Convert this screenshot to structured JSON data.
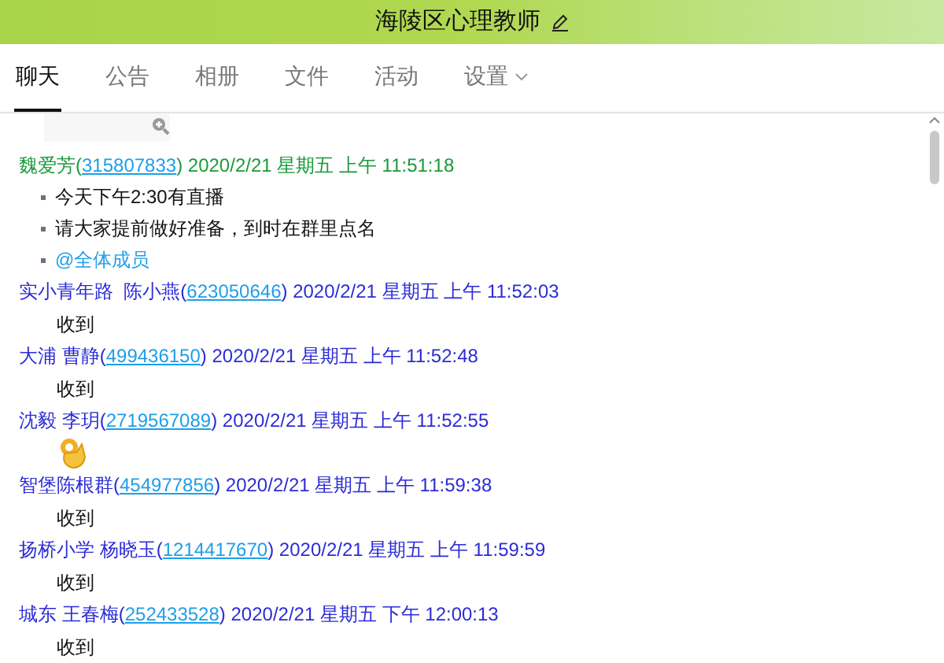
{
  "window": {
    "title": "海陵区心理教师"
  },
  "tabs": [
    {
      "label": "聊天",
      "selected": true
    },
    {
      "label": "公告",
      "selected": false
    },
    {
      "label": "相册",
      "selected": false
    },
    {
      "label": "文件",
      "selected": false
    },
    {
      "label": "活动",
      "selected": false
    },
    {
      "label": "设置",
      "selected": false,
      "dropdown": true
    }
  ],
  "messages": [
    {
      "name": "魏爱芳(",
      "qq": "315807833",
      "time": ") 2020/2/21 星期五 上午 11:51:18",
      "color": "#1a9a3a",
      "lines": [
        {
          "kind": "bullet",
          "text": "今天下午2:30有直播"
        },
        {
          "kind": "bullet",
          "text": "请大家提前做好准备，到时在群里点名"
        },
        {
          "kind": "mention",
          "text": "@全体成员"
        }
      ]
    },
    {
      "name": "实小青年路  陈小燕(",
      "qq": "623050646",
      "time": ") 2020/2/21 星期五 上午 11:52:03",
      "color": "#2b2bd6",
      "lines": [
        {
          "kind": "text",
          "text": "收到"
        }
      ]
    },
    {
      "name": "大浦 曹静(",
      "qq": "499436150",
      "time": ") 2020/2/21 星期五 上午 11:52:48",
      "color": "#2b2bd6",
      "lines": [
        {
          "kind": "text",
          "text": "收到"
        }
      ]
    },
    {
      "name": "沈毅 李玥(",
      "qq": "2719567089",
      "time": ") 2020/2/21 星期五 上午 11:52:55",
      "color": "#2b2bd6",
      "lines": [
        {
          "kind": "emoji"
        }
      ]
    },
    {
      "name": "智堡陈根群(",
      "qq": "454977856",
      "time": ") 2020/2/21 星期五 上午 11:59:38",
      "color": "#2b2bd6",
      "lines": [
        {
          "kind": "text",
          "text": "收到"
        }
      ]
    },
    {
      "name": "扬桥小学 杨晓玉(",
      "qq": "1214417670",
      "time": ") 2020/2/21 星期五 上午 11:59:59",
      "color": "#2b2bd6",
      "lines": [
        {
          "kind": "text",
          "text": "收到"
        }
      ]
    },
    {
      "name": "城东 王春梅(",
      "qq": "252433528",
      "time": ") 2020/2/21 星期五 下午 12:00:13",
      "color": "#2b2bd6",
      "lines": [
        {
          "kind": "text",
          "text": "收到"
        }
      ]
    }
  ]
}
